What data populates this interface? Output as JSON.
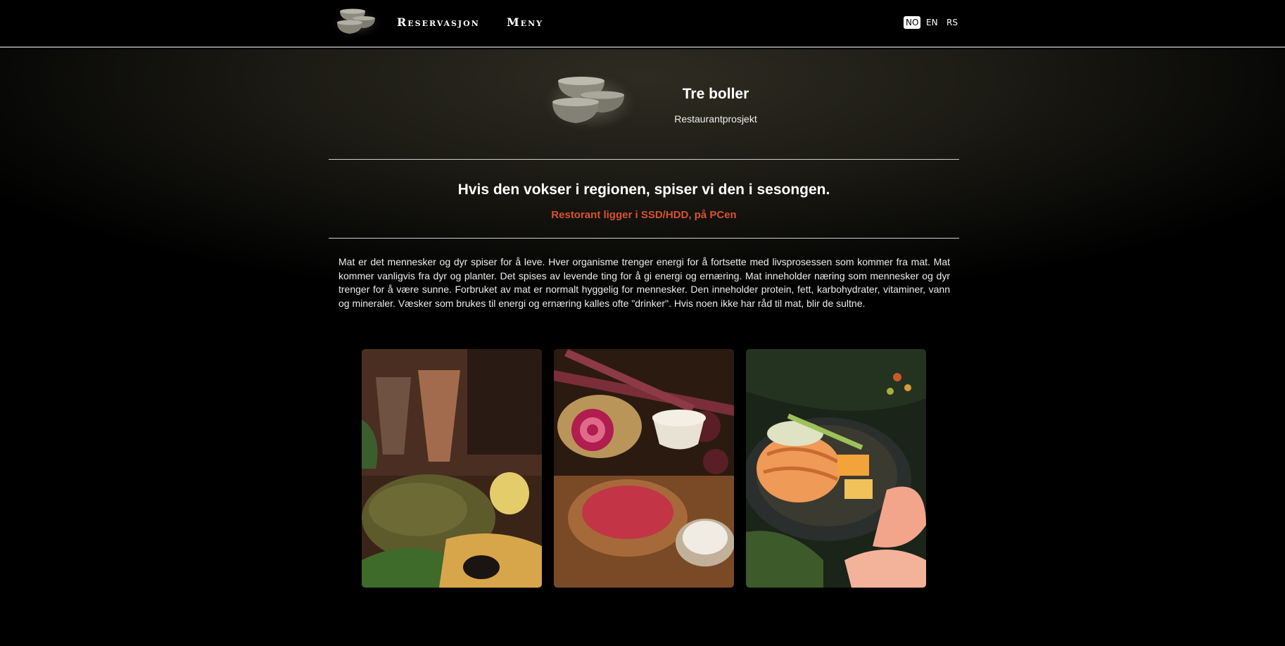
{
  "nav": {
    "links": [
      {
        "label": "Reservasjon"
      },
      {
        "label": "Meny"
      }
    ],
    "languages": [
      {
        "code": "NO",
        "active": true
      },
      {
        "code": "EN",
        "active": false
      },
      {
        "code": "RS",
        "active": false
      }
    ]
  },
  "brand": {
    "title": "Tre boller",
    "subtitle": "Restaurantprosjekt"
  },
  "intro": {
    "tagline": "Hvis den vokser i regionen, spiser vi den i sesongen.",
    "location_note": "Restorant ligger i SSD/HDD, på PCen",
    "description": "Mat er det mennesker og dyr spiser for å leve. Hver organisme trenger energi for å fortsette med livsprosessen som kommer fra mat. Mat kommer vanligvis fra dyr og planter. Det spises av levende ting for å gi energi og ernæring. Mat inneholder næring som mennesker og dyr trenger for å være sunne. Forbruket av mat er normalt hyggelig for mennesker. Den inneholder protein, fett, karbohydrater, vitaminer, vann og mineraler. Væsker som brukes til energi og ernæring kalles ofte \"drinker\". Hvis noen ikke har råd til mat, blir de sultne."
  },
  "gallery": [
    {
      "icon": "roast-meat-photo"
    },
    {
      "icon": "beetroot-photo"
    },
    {
      "icon": "salmon-pan-photo"
    }
  ],
  "colors": {
    "accent": "#d9532c",
    "background": "#000000"
  }
}
